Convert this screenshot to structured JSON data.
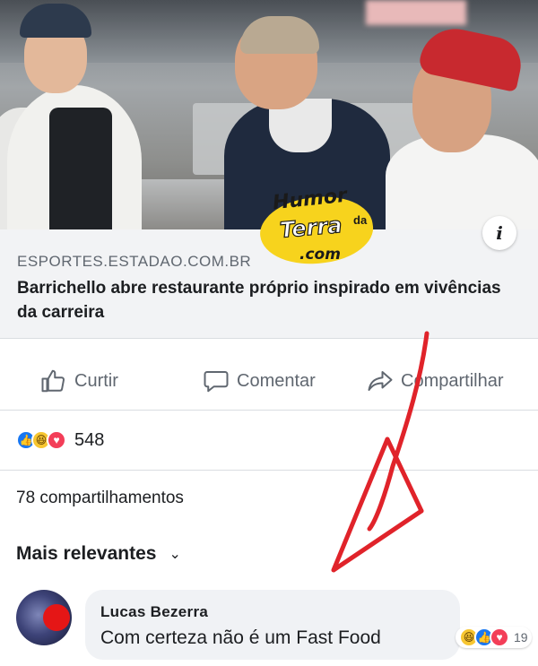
{
  "link_preview": {
    "domain": "ESPORTES.ESTADAO.COM.BR",
    "title": "Barrichello abre restaurante próprio inspirado em vivências da carreira",
    "info_icon": "i"
  },
  "watermark": {
    "line1": "Humor",
    "da": "da",
    "line2": "Terra",
    "line3": ".com",
    "color": "#f7d31d"
  },
  "actions": {
    "like_label": "Curtir",
    "comment_label": "Comentar",
    "share_label": "Compartilhar"
  },
  "reactions": {
    "icons": [
      "like-reaction",
      "haha-reaction",
      "love-reaction"
    ],
    "count": "548"
  },
  "shares_text": "78 compartilhamentos",
  "sort_label": "Mais relevantes",
  "comment": {
    "author": "Lucas Bezerra",
    "text": "Com certeza não é um Fast Food",
    "reaction_icons": [
      "haha-reaction",
      "like-reaction",
      "love-reaction"
    ],
    "reaction_count": "19"
  },
  "colors": {
    "accent_blue": "#1877f2",
    "love_red": "#f33e58",
    "haha_yellow": "#f7c631",
    "annotation_arrow": "#e0232a"
  }
}
